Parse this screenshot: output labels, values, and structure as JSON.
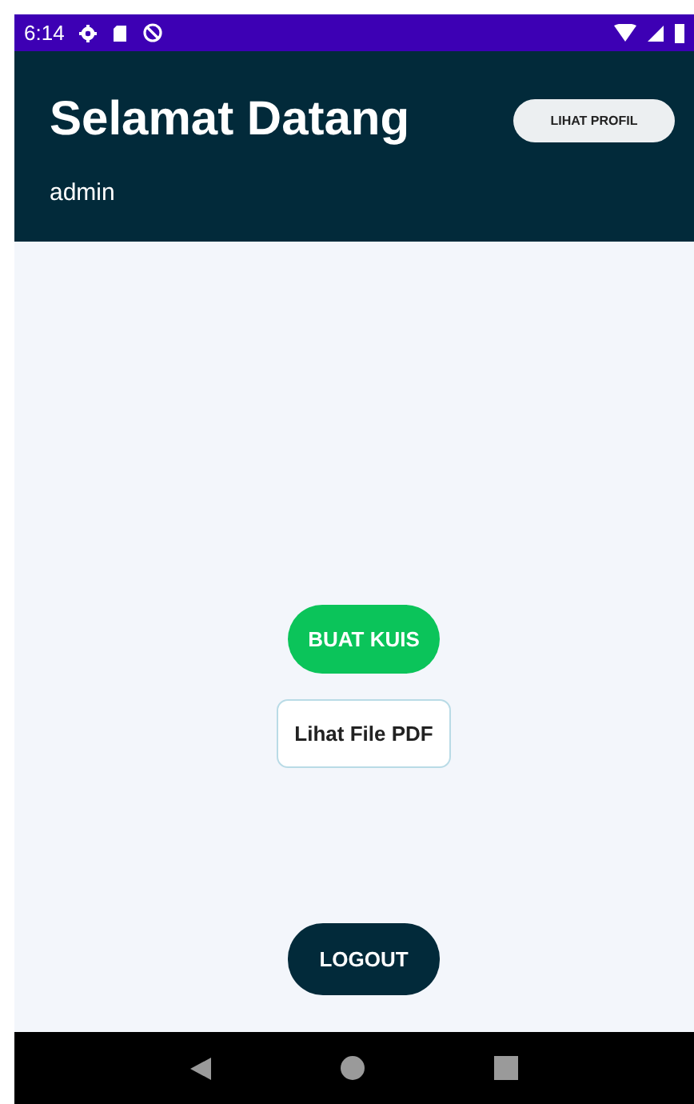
{
  "status_bar": {
    "time": "6:14"
  },
  "header": {
    "title": "Selamat Datang",
    "subtitle": "admin",
    "profile_button": "LIHAT PROFIL"
  },
  "actions": [
    {
      "label": "BUAT KUIS",
      "kind": "primary"
    },
    {
      "label": "Lihat File PDF",
      "kind": "outline"
    }
  ],
  "logout_button": "LOGOUT"
}
